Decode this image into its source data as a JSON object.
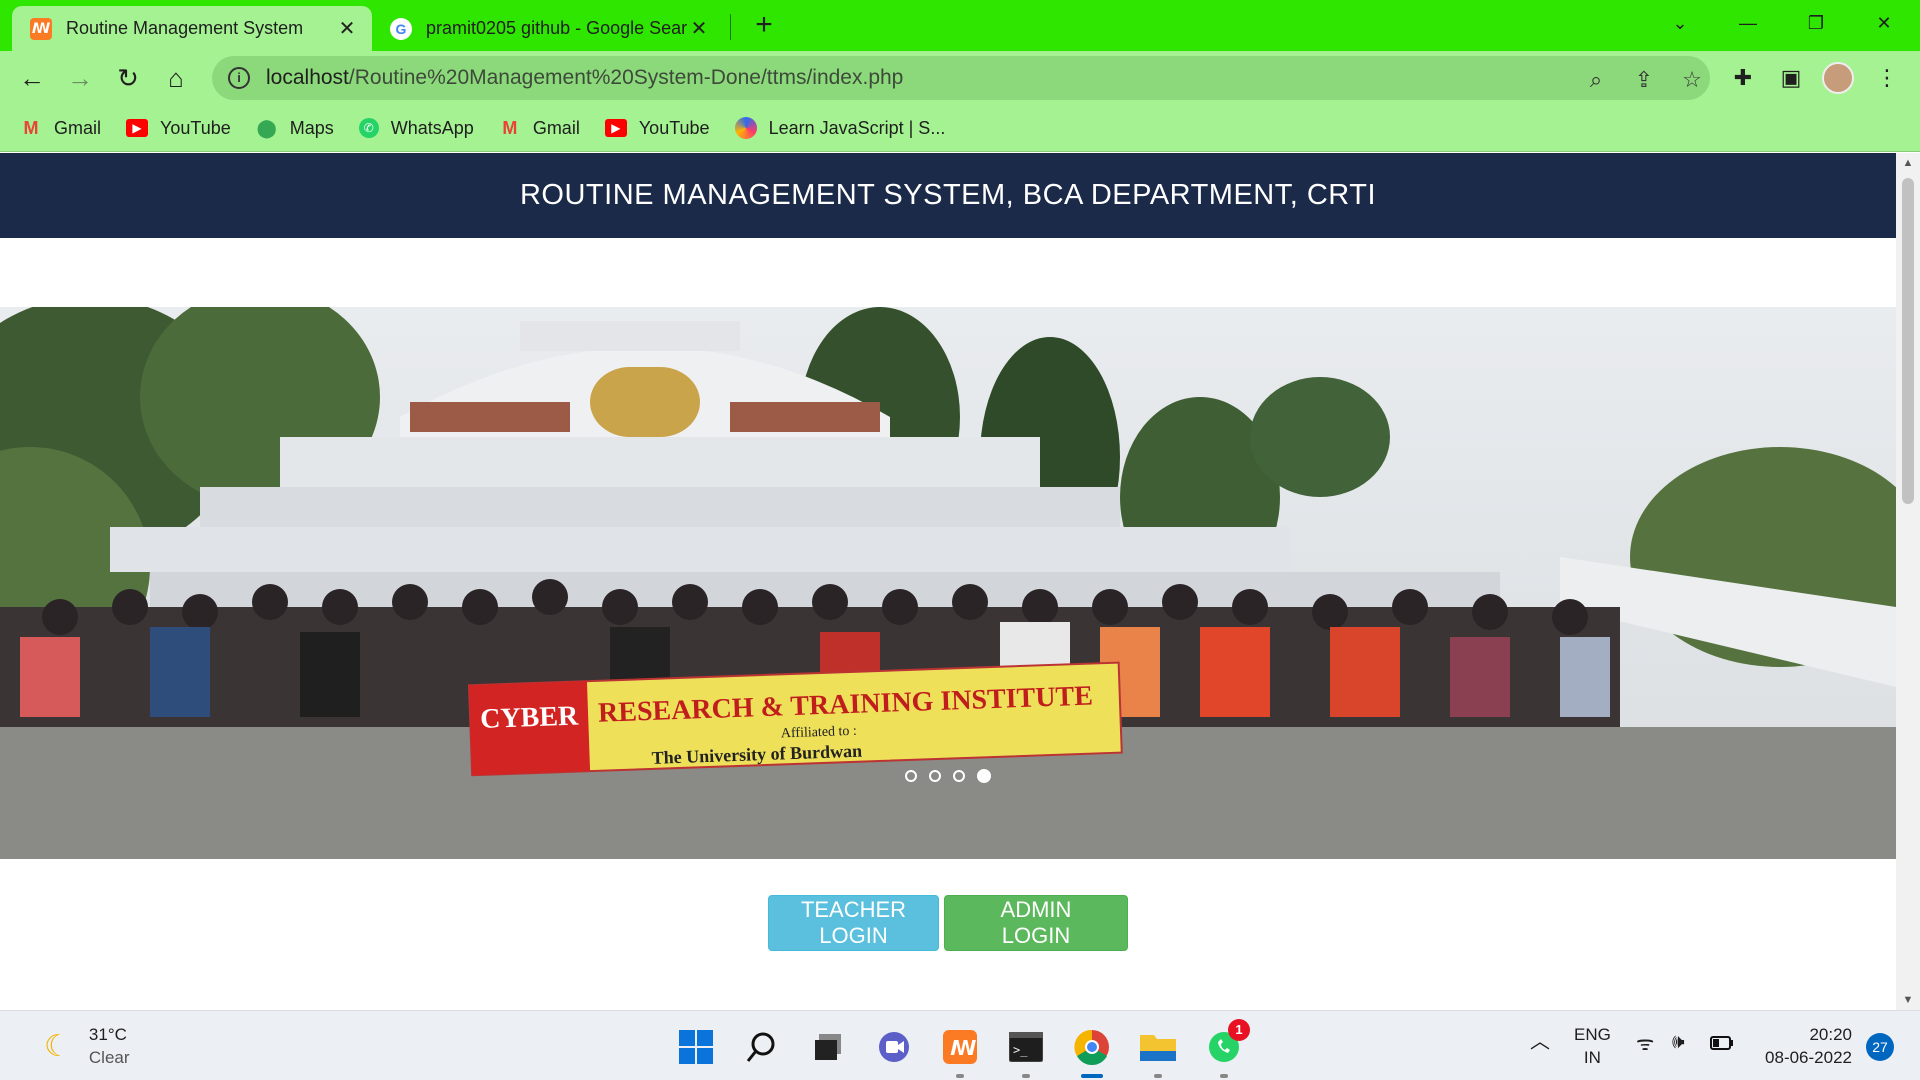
{
  "browser": {
    "tabs": [
      {
        "title": "Routine Management System",
        "favicon": "xampp-icon",
        "active": true
      },
      {
        "title": "pramit0205 github - Google Sear",
        "favicon": "google-icon",
        "active": false
      }
    ],
    "address": {
      "host": "localhost",
      "path": "/Routine%20Management%20System-Done/ttms/index.php"
    },
    "bookmarks": [
      {
        "label": "Gmail",
        "icon": "gmail-icon",
        "color": "#ea4335"
      },
      {
        "label": "YouTube",
        "icon": "youtube-icon",
        "color": "#ff0000"
      },
      {
        "label": "Maps",
        "icon": "maps-icon",
        "color": "#34a853"
      },
      {
        "label": "WhatsApp",
        "icon": "whatsapp-icon",
        "color": "#25d366"
      },
      {
        "label": "Gmail",
        "icon": "gmail-icon",
        "color": "#ea4335"
      },
      {
        "label": "YouTube",
        "icon": "youtube-icon",
        "color": "#ff0000"
      },
      {
        "label": "Learn JavaScript | S...",
        "icon": "scrimba-icon",
        "color": "#2b6cf0"
      }
    ],
    "colors": {
      "tabstrip": "#2ee600",
      "toolbar": "#a4f291"
    }
  },
  "page": {
    "header": {
      "title": "ROUTINE MANAGEMENT SYSTEM, BCA DEPARTMENT, CRTI",
      "background": "#1c2a4a"
    },
    "carousel": {
      "banner_line1_red": "CYBER",
      "banner_line1": "RESEARCH & TRAINING INSTITUTE",
      "banner_line2": "Affiliated to :",
      "banner_line3": "The University of Burdwan",
      "slides": 4,
      "active_slide": 4
    },
    "buttons": {
      "teacher_login": "TEACHER LOGIN",
      "admin_login": "ADMIN LOGIN"
    }
  },
  "taskbar": {
    "weather": {
      "temp": "31°C",
      "condition": "Clear"
    },
    "apps": [
      "windows-start-icon",
      "search-icon",
      "task-view-icon",
      "teams-chat-icon",
      "xampp-icon",
      "terminal-icon",
      "chrome-icon",
      "file-explorer-icon",
      "whatsapp-icon"
    ],
    "whatsapp_badge": "1",
    "language": {
      "line1": "ENG",
      "line2": "IN"
    },
    "time": "20:20",
    "date": "08-06-2022",
    "notifications": "27"
  }
}
